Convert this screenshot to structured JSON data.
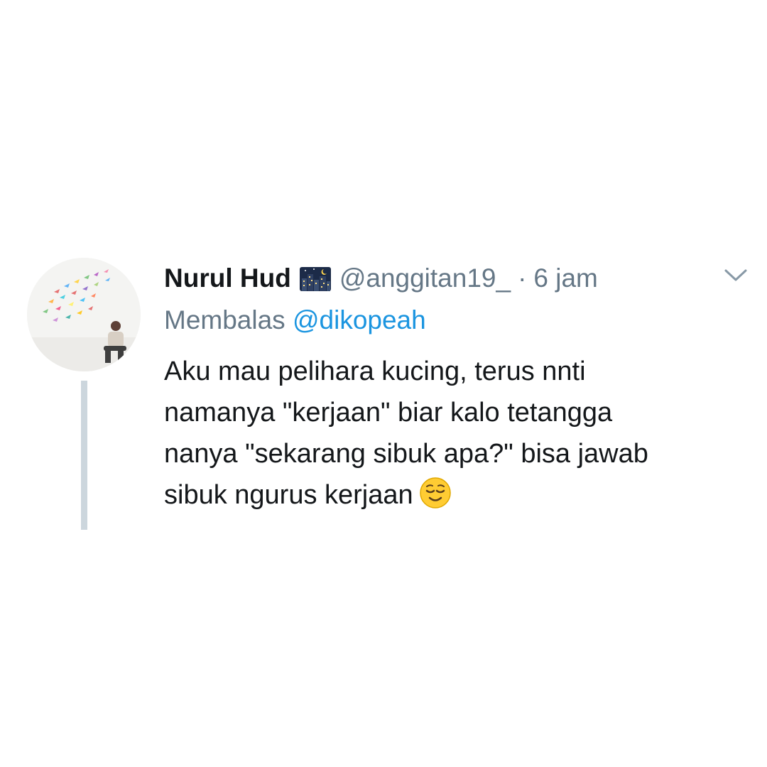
{
  "tweet": {
    "display_name": "Nurul Hud",
    "name_emoji": "city-at-night-emoji",
    "handle": "@anggitan19_",
    "separator": "·",
    "time": "6 jam",
    "reply_prefix": "Membalas",
    "reply_to": "@dikopeah",
    "body_lines": [
      "Aku mau pelihara kucing, terus nnti",
      "namanya \"kerjaan\" biar kalo tetangga",
      "nanya \"sekarang sibuk apa?\" bisa jawab",
      "sibuk ngurus kerjaan"
    ],
    "body_emoji": "relieved-face-emoji"
  },
  "colors": {
    "text_primary": "#14171a",
    "text_secondary": "#657786",
    "link": "#1b95e0",
    "thread_line": "#ccd6dd",
    "background": "#ffffff"
  }
}
